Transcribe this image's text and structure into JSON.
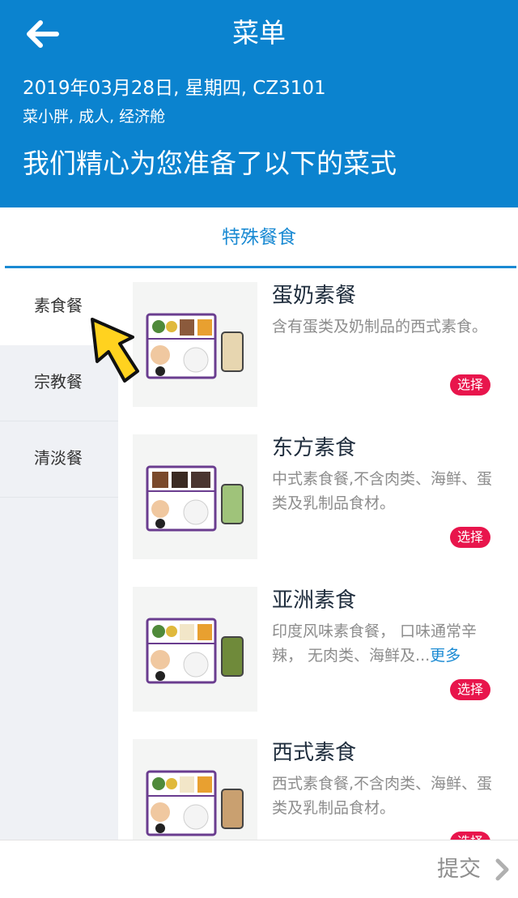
{
  "header": {
    "title": "菜单",
    "flight_line": "2019年03月28日, 星期四, CZ3101",
    "passenger_line": "菜小胖, 成人, 经济舱",
    "headline": "我们精心为您准备了以下的菜式",
    "color": "#0b83cf"
  },
  "tab": {
    "label": "特殊餐食",
    "color": "#1a8ad3"
  },
  "sidebar": {
    "items": [
      {
        "label": "素食餐",
        "active": true
      },
      {
        "label": "宗教餐",
        "active": false
      },
      {
        "label": "清淡餐",
        "active": false
      }
    ]
  },
  "meals": [
    {
      "name": "蛋奶素餐",
      "desc": "含有蛋类及奶制品的西式素食。",
      "select_label": "选择"
    },
    {
      "name": "东方素食",
      "desc": "中式素食餐,不含肉类、海鲜、蛋类及乳制品食材。",
      "select_label": "选择"
    },
    {
      "name": "亚洲素食",
      "desc": "印度风味素食餐， 口味通常辛辣， 无肉类、海鲜及...",
      "more_label": "更多",
      "select_label": "选择"
    },
    {
      "name": "西式素食",
      "desc": "西式素食餐,不含肉类、海鲜、蛋类及乳制品食材。",
      "select_label": "选择"
    }
  ],
  "footer": {
    "submit_label": "提交"
  },
  "colors": {
    "accent": "#1a8ad3",
    "select": "#e8154c",
    "pointer": "#ffd21f"
  },
  "icons": {
    "back": "arrow-left-icon",
    "submit": "chevron-right-icon",
    "pointer": "arrow-pointer-icon"
  }
}
